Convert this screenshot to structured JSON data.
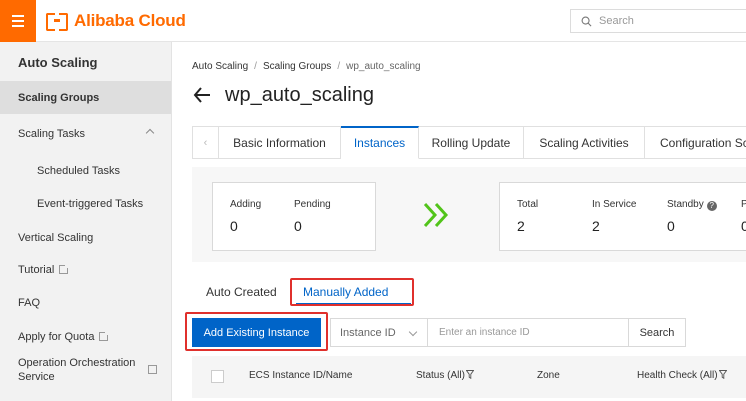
{
  "brand": {
    "name": "Alibaba Cloud",
    "color": "#ff6a00"
  },
  "search": {
    "placeholder": "Search"
  },
  "sidebar": {
    "title": "Auto Scaling",
    "items": [
      {
        "label": "Scaling Groups",
        "active": true
      },
      {
        "label": "Scaling Tasks",
        "expandable": true
      },
      {
        "label": "Scheduled Tasks"
      },
      {
        "label": "Event-triggered Tasks"
      },
      {
        "label": "Vertical Scaling"
      },
      {
        "label": "Tutorial",
        "external": true
      },
      {
        "label": "FAQ"
      },
      {
        "label": "Apply for Quota",
        "external": true
      },
      {
        "label": "Operation Orchestration Service",
        "external": true
      }
    ]
  },
  "breadcrumb": {
    "items": [
      "Auto Scaling",
      "Scaling Groups",
      "wp_auto_scaling"
    ],
    "separator": "/"
  },
  "page": {
    "title": "wp_auto_scaling"
  },
  "tabs": [
    {
      "label": "Basic Information"
    },
    {
      "label": "Instances",
      "active": true
    },
    {
      "label": "Rolling Update"
    },
    {
      "label": "Scaling Activities"
    },
    {
      "label": "Configuration Sc"
    }
  ],
  "stats": {
    "left": [
      {
        "label": "Adding",
        "value": "0"
      },
      {
        "label": "Pending",
        "value": "0"
      }
    ],
    "right": [
      {
        "label": "Total",
        "value": "2"
      },
      {
        "label": "In Service",
        "value": "2"
      },
      {
        "label": "Standby",
        "value": "0"
      },
      {
        "label": "P",
        "value": "0"
      }
    ]
  },
  "subtabs": {
    "auto": "Auto Created",
    "manual": "Manually Added"
  },
  "toolbar": {
    "add_label": "Add Existing Instance",
    "filter_select": "Instance ID",
    "input_placeholder": "Enter an instance ID",
    "search_label": "Search"
  },
  "table": {
    "columns": [
      "ECS Instance ID/Name",
      "Status (All)",
      "Zone",
      "Health Check (All)"
    ]
  },
  "colors": {
    "accent": "#0064c8",
    "highlight": "#e0302c",
    "brand": "#ff6a00"
  }
}
